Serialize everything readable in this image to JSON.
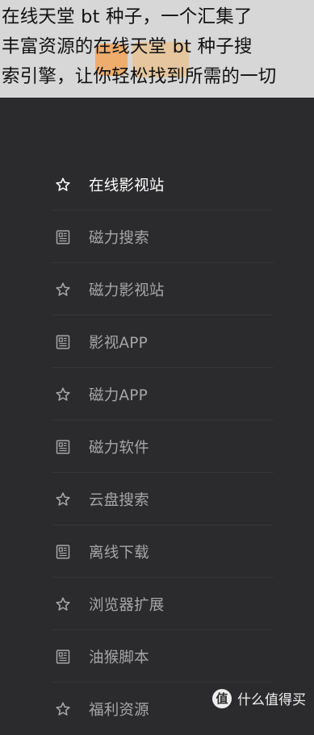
{
  "banner": {
    "text": "在线天堂 bt 种子，一个汇集了\n丰富资源的在线天堂 bt 种子搜\n索引擎，让你轻松找到所需的一切"
  },
  "menu": {
    "items": [
      {
        "label": "在线影视站",
        "icon": "star-icon",
        "active": true
      },
      {
        "label": "磁力搜索",
        "icon": "document-icon",
        "active": false
      },
      {
        "label": "磁力影视站",
        "icon": "star-icon",
        "active": false
      },
      {
        "label": "影视APP",
        "icon": "document-icon",
        "active": false
      },
      {
        "label": "磁力APP",
        "icon": "star-icon",
        "active": false
      },
      {
        "label": "磁力软件",
        "icon": "document-icon",
        "active": false
      },
      {
        "label": "云盘搜索",
        "icon": "star-icon",
        "active": false
      },
      {
        "label": "离线下载",
        "icon": "document-icon",
        "active": false
      },
      {
        "label": "浏览器扩展",
        "icon": "star-icon",
        "active": false
      },
      {
        "label": "油猴脚本",
        "icon": "document-icon",
        "active": false
      },
      {
        "label": "福利资源",
        "icon": "star-icon",
        "active": false
      }
    ]
  },
  "watermark": {
    "badge": "值",
    "text": "什么值得买"
  },
  "colors": {
    "background": "#2b2b2d",
    "active_text": "#ffffff",
    "inactive_text": "#a6a6a8",
    "banner_bg": "#d7d7d7"
  }
}
